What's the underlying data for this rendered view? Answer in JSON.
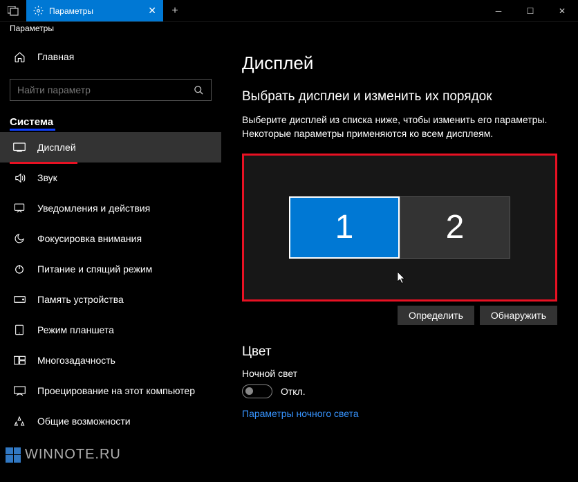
{
  "titlebar": {
    "tab_title": "Параметры",
    "close_glyph": "✕",
    "new_tab_glyph": "+",
    "minimize_glyph": "─",
    "maximize_glyph": "☐"
  },
  "breadcrumb": "Параметры",
  "sidebar": {
    "home_label": "Главная",
    "search_placeholder": "Найти параметр",
    "category": "Система",
    "items": [
      {
        "label": "Дисплей"
      },
      {
        "label": "Звук"
      },
      {
        "label": "Уведомления и действия"
      },
      {
        "label": "Фокусировка внимания"
      },
      {
        "label": "Питание и спящий режим"
      },
      {
        "label": "Память устройства"
      },
      {
        "label": "Режим планшета"
      },
      {
        "label": "Многозадачность"
      },
      {
        "label": "Проецирование на этот компьютер"
      },
      {
        "label": "Общие возможности"
      }
    ]
  },
  "content": {
    "title": "Дисплей",
    "arrange_heading": "Выбрать дисплеи и изменить их порядок",
    "arrange_desc": "Выберите дисплей из списка ниже, чтобы изменить его параметры. Некоторые параметры применяются ко всем дисплеям.",
    "monitor1": "1",
    "monitor2": "2",
    "btn_identify": "Определить",
    "btn_detect": "Обнаружить",
    "color_heading": "Цвет",
    "night_light_label": "Ночной свет",
    "toggle_off": "Откл.",
    "night_light_link": "Параметры ночного света"
  },
  "watermark": "WINNOTE.RU"
}
